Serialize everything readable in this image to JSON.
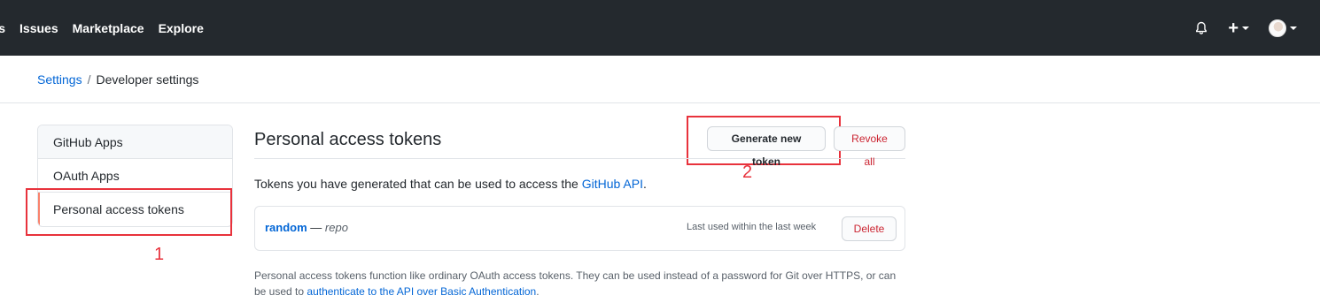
{
  "topnav": {
    "items": [
      "ests",
      "Issues",
      "Marketplace",
      "Explore"
    ]
  },
  "header_icons": {
    "bell": "bell-icon",
    "plus": "+",
    "avatar": "avatar"
  },
  "breadcrumb": {
    "parent": "Settings",
    "separator": "/",
    "current": "Developer settings"
  },
  "sidebar": {
    "items": [
      {
        "label": "GitHub Apps"
      },
      {
        "label": "OAuth Apps"
      },
      {
        "label": "Personal access tokens",
        "selected": true
      }
    ]
  },
  "main": {
    "title": "Personal access tokens",
    "generate_label": "Generate new token",
    "revoke_label": "Revoke all",
    "description_prefix": "Tokens you have generated that can be used to access the ",
    "description_link": "GitHub API",
    "description_suffix": ".",
    "token": {
      "name": "random",
      "dash": " — ",
      "scope": "repo",
      "last_used": "Last used within the last week",
      "delete_label": "Delete"
    },
    "note_text": "Personal access tokens function like ordinary OAuth access tokens. They can be used instead of a password for Git over HTTPS, or can be used to ",
    "note_link": "authenticate to the API over Basic Authentication",
    "note_suffix": "."
  },
  "annotations": {
    "label1": "1",
    "label2": "2"
  },
  "colors": {
    "header_bg": "#24292e",
    "link": "#0366d6",
    "danger": "#cb2431",
    "annotation_red": "#e8323c",
    "selected_accent": "#f9826c"
  }
}
